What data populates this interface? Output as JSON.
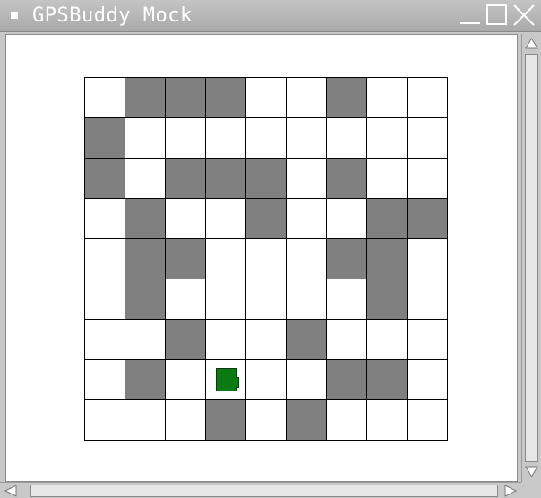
{
  "window": {
    "title": "GPSBuddy Mock"
  },
  "colors": {
    "blocked": "#808080",
    "open": "#ffffff",
    "grid_line": "#000000",
    "robot": "#0a7a12",
    "titlebar": "#a9a9a9"
  },
  "icons": {
    "window_menu": "square-icon",
    "minimize": "minimize-icon",
    "maximize": "maximize-icon",
    "close": "close-icon",
    "scroll_up": "arrow-up-icon",
    "scroll_down": "arrow-down-icon",
    "scroll_left": "arrow-left-icon",
    "scroll_right": "arrow-right-icon",
    "robot": "robot-icon"
  },
  "grid": {
    "rows": 9,
    "cols": 9,
    "cells": [
      [
        0,
        1,
        1,
        1,
        0,
        0,
        1,
        0,
        0
      ],
      [
        1,
        0,
        0,
        0,
        0,
        0,
        0,
        0,
        0
      ],
      [
        1,
        0,
        1,
        1,
        1,
        0,
        1,
        0,
        0
      ],
      [
        0,
        1,
        0,
        0,
        1,
        0,
        0,
        1,
        1
      ],
      [
        0,
        1,
        1,
        0,
        0,
        0,
        1,
        1,
        0
      ],
      [
        0,
        1,
        0,
        0,
        0,
        0,
        0,
        1,
        0
      ],
      [
        0,
        0,
        1,
        0,
        0,
        1,
        0,
        0,
        0
      ],
      [
        0,
        1,
        0,
        0,
        0,
        0,
        1,
        1,
        0
      ],
      [
        0,
        0,
        0,
        1,
        0,
        1,
        0,
        0,
        0
      ]
    ],
    "robot": {
      "row": 7,
      "col": 3,
      "facing": "right"
    }
  }
}
